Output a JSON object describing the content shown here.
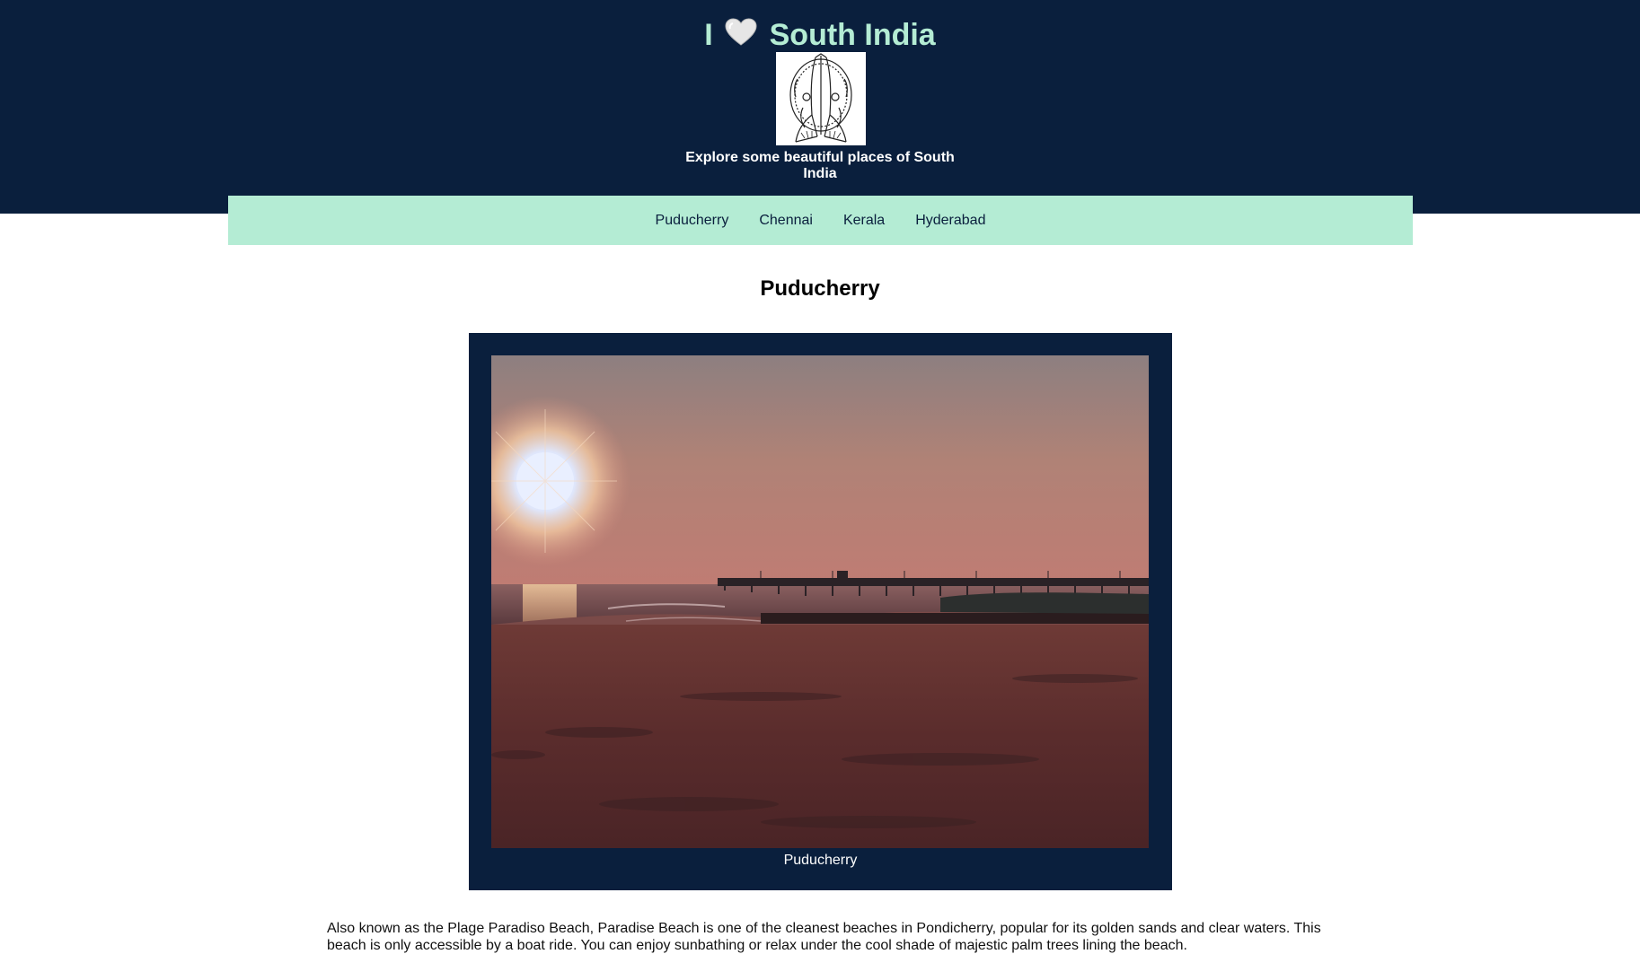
{
  "header": {
    "title_prefix": "I",
    "title_suffix": "South India",
    "heart_icon": "heart-icon",
    "logo_icon": "namaste-hands-icon",
    "tagline": "Explore some beautiful places of South India",
    "colors": {
      "header_bg": "#0a1f3d",
      "accent": "#b4ecd4"
    }
  },
  "nav": {
    "items": [
      {
        "label": "Puducherry"
      },
      {
        "label": "Chennai"
      },
      {
        "label": "Kerala"
      },
      {
        "label": "Hyderabad"
      }
    ]
  },
  "main": {
    "heading": "Puducherry",
    "figure": {
      "image": "beach-sunset-pier-photo",
      "caption": "Puducherry"
    },
    "description": "Also known as the Plage Paradiso Beach, Paradise Beach is one of the cleanest beaches in Pondicherry, popular for its golden sands and clear waters. This beach is only accessible by a boat ride. You can enjoy sunbathing or relax under the cool shade of majestic palm trees lining the beach."
  }
}
